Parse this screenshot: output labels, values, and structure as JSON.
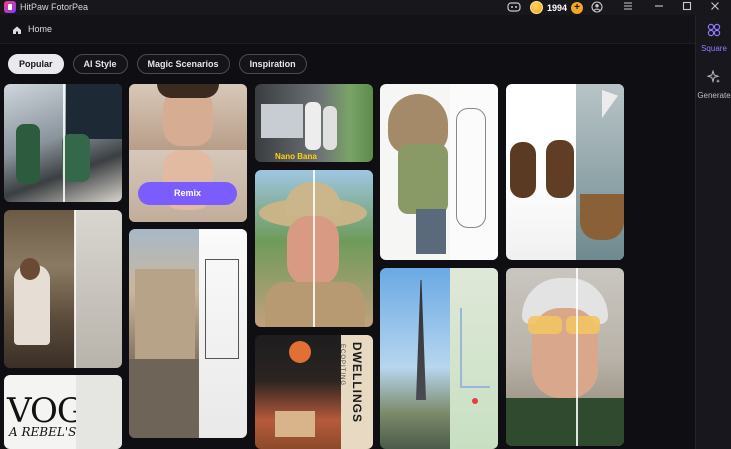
{
  "app": {
    "title": "HitPaw FotorPea",
    "credits": "1994"
  },
  "breadcrumb": {
    "home": "Home"
  },
  "tabs": [
    {
      "label": "Popular",
      "active": true
    },
    {
      "label": "AI Style",
      "active": false
    },
    {
      "label": "Magic Scenarios",
      "active": false
    },
    {
      "label": "Inspiration",
      "active": false
    }
  ],
  "rightbar": {
    "square": "Square",
    "generate": "Generate"
  },
  "gallery": {
    "remix_label": "Remix",
    "nano_label": "Nano Bana",
    "vogue_text": "VOG",
    "vogue_sub": "A REBEL'S",
    "poster_text": "DWELLINGS",
    "poster_sub": "ECOPITING"
  },
  "colors": {
    "accent": "#7b5cff",
    "coin": "#f5a623"
  }
}
